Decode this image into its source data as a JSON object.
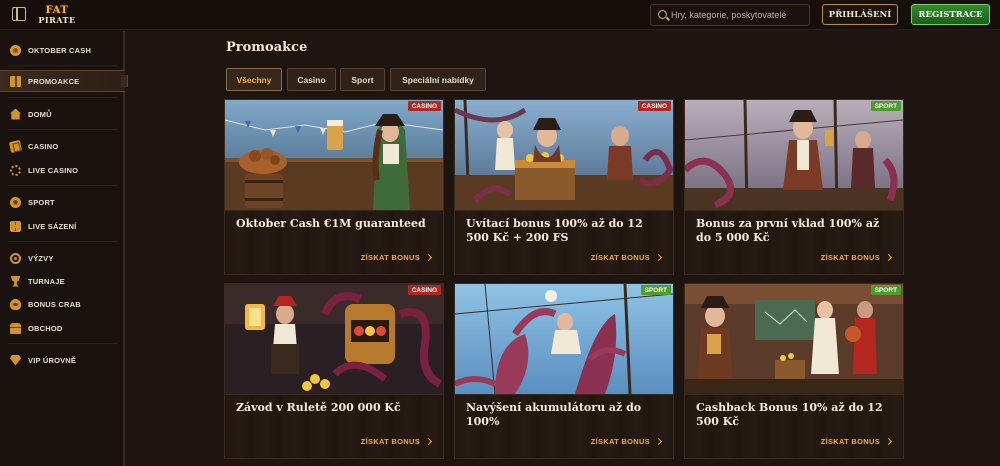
{
  "header": {
    "logo_line1": "FAT",
    "logo_line2": "PIRATE",
    "search_placeholder": "Hry, kategorie, poskytovatelé",
    "login_label": "PŘIHLÁŠENÍ",
    "register_label": "REGISTRACE"
  },
  "sidebar": {
    "items": [
      {
        "label": "OKTOBER CASH",
        "icon": "coin-icon"
      },
      {
        "label": "PROMOAKCE",
        "icon": "gift-icon",
        "active": true
      },
      {
        "label": "DOMŮ",
        "icon": "home-icon"
      },
      {
        "label": "CASINO",
        "icon": "cards-icon"
      },
      {
        "label": "LIVE CASINO",
        "icon": "chip-icon"
      },
      {
        "label": "SPORT",
        "icon": "soccer-ball-icon"
      },
      {
        "label": "LIVE SÁZENÍ",
        "icon": "ticket-icon"
      },
      {
        "label": "VÝZVY",
        "icon": "target-icon"
      },
      {
        "label": "TURNAJE",
        "icon": "trophy-icon"
      },
      {
        "label": "BONUS CRAB",
        "icon": "crab-icon"
      },
      {
        "label": "OBCHOD",
        "icon": "chest-icon"
      },
      {
        "label": "VIP ÚROVNĚ",
        "icon": "gem-icon"
      }
    ]
  },
  "main": {
    "title": "Promoakce",
    "filters": [
      {
        "label": "Všechny",
        "active": true
      },
      {
        "label": "Casino"
      },
      {
        "label": "Sport"
      },
      {
        "label": "Speciální nabídky"
      }
    ],
    "cards": [
      {
        "badge": "CASINO",
        "title": "Oktober Cash €1M guaranteed",
        "cta": "ZÍSKAT BONUS"
      },
      {
        "badge": "CASINO",
        "title": "Uvítací bonus 100% až do 12 500 Kč + 200 FS",
        "cta": "ZÍSKAT BONUS"
      },
      {
        "badge": "SPORT",
        "title": "Bonus za první vklad 100% až do 5 000 Kč",
        "cta": "ZÍSKAT BONUS"
      },
      {
        "badge": "CASINO",
        "title": "Závod v Ruletě 200 000 Kč",
        "cta": "ZÍSKAT BONUS"
      },
      {
        "badge": "SPORT",
        "title": "Navýšení akumulátoru až do 100%",
        "cta": "ZÍSKAT BONUS"
      },
      {
        "badge": "SPORT",
        "title": "Cashback Bonus 10% až do 12 500 Kč",
        "cta": "ZÍSKAT BONUS"
      }
    ]
  },
  "colors": {
    "accent": "#f0a93a",
    "casino_badge": "#b3271e",
    "sport_badge": "#4f9c2c",
    "register_button": "#2f8b2c"
  }
}
